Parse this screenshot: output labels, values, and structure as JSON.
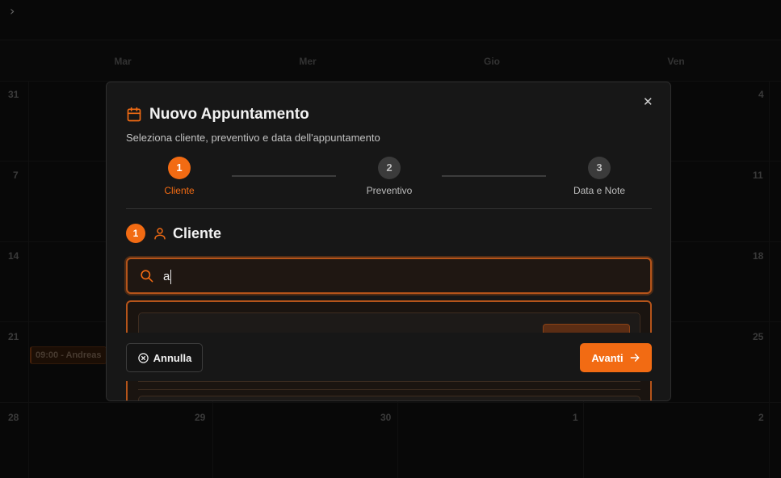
{
  "calendar": {
    "day_names": [
      "Mar",
      "Mer",
      "Gio",
      "Ven"
    ],
    "rows": [
      {
        "left": "31",
        "right": "4"
      },
      {
        "left": "7",
        "right": "11"
      },
      {
        "left": "14",
        "right": "18"
      },
      {
        "left": "21",
        "right": "25"
      }
    ],
    "last_row": [
      "28",
      "29",
      "30",
      "1",
      "2"
    ],
    "event": "09:00 - Andreas"
  },
  "modal": {
    "title": "Nuovo Appuntamento",
    "subtitle": "Seleziona cliente, preventivo e data dell'appuntamento",
    "close_icon": "close-icon",
    "steps": [
      {
        "number": "1",
        "label": "Cliente",
        "active": true
      },
      {
        "number": "2",
        "label": "Preventivo",
        "active": false
      },
      {
        "number": "3",
        "label": "Data e Note",
        "active": false
      }
    ],
    "section": {
      "number": "1",
      "title": "Cliente"
    },
    "search": {
      "value": "a",
      "placeholder": ""
    },
    "footer": {
      "cancel_label": "Annulla",
      "next_label": "Avanti"
    }
  },
  "colors": {
    "accent": "#f26b13",
    "background": "#0d0d0d",
    "modal_bg": "#171717"
  }
}
